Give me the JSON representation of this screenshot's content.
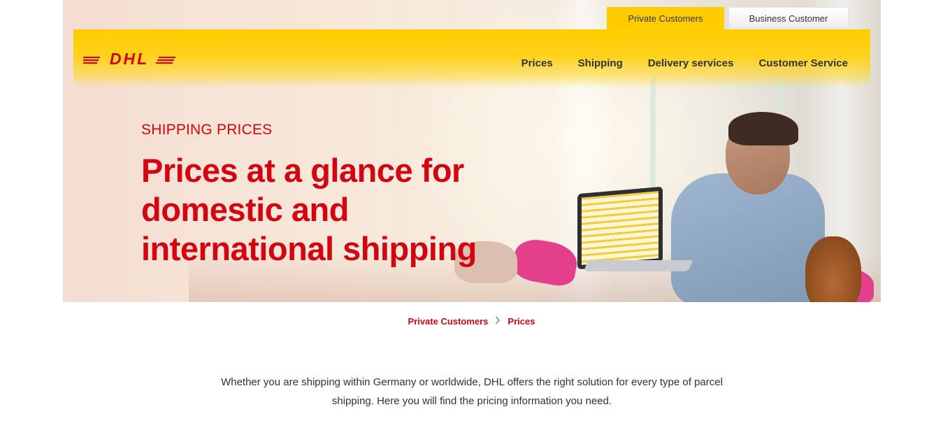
{
  "top_tabs": [
    {
      "label": "Private Customers",
      "active": true
    },
    {
      "label": "Business Customer",
      "active": false
    }
  ],
  "logo": {
    "text": "DHL",
    "color": "#d40511",
    "icon": "dhl-logo-icon"
  },
  "nav": {
    "items": [
      "Prices",
      "Shipping",
      "Delivery services",
      "Customer Service"
    ]
  },
  "hero": {
    "eyebrow": "SHIPPING PRICES",
    "headline_lines": [
      "Prices at a glance for",
      "domestic and",
      "international shipping"
    ]
  },
  "breadcrumb": {
    "items": [
      "Private Customers",
      "Prices"
    ],
    "separator_icon": "chevron-right-icon"
  },
  "intro": {
    "text": "Whether you are shipping within Germany or worldwide, DHL offers the right solution for every type of parcel shipping. Here you will find the pricing information you need."
  },
  "colors": {
    "brand_yellow": "#ffcc00",
    "brand_red": "#d40511",
    "text": "#333333"
  }
}
